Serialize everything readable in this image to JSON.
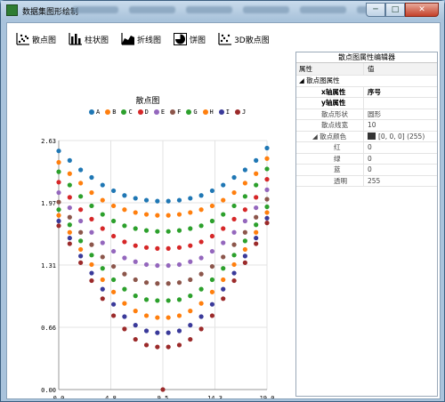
{
  "window": {
    "title": "数据集图形绘制",
    "controls": {
      "minimize": "─",
      "maximize": "□",
      "close": "✕"
    }
  },
  "toolbar": {
    "items": [
      {
        "label": "散点图",
        "icon": "scatter-icon"
      },
      {
        "label": "柱状图",
        "icon": "bar-icon"
      },
      {
        "label": "折线图",
        "icon": "area-icon"
      },
      {
        "label": "饼图",
        "icon": "pie-icon"
      },
      {
        "label": "3D散点图",
        "icon": "scatter3d-icon"
      }
    ]
  },
  "chart_data": {
    "type": "scatter",
    "title": "散点图",
    "xlim": [
      0.0,
      19.0
    ],
    "ylim": [
      0.0,
      2.63
    ],
    "xticks": [
      "0.0",
      "4.8",
      "9.5",
      "14.3",
      "19.0"
    ],
    "yticks": [
      "0.00",
      "0.66",
      "1.31",
      "1.97",
      "2.63"
    ],
    "grid": true,
    "legend_position": "top",
    "x": [
      0,
      1,
      2,
      3,
      4,
      5,
      6,
      7,
      8,
      9,
      10,
      11,
      12,
      13,
      14,
      15,
      16,
      17,
      18,
      19
    ],
    "series": [
      {
        "name": "A",
        "color": "#1f77b4",
        "values": [
          2.52,
          2.42,
          2.32,
          2.24,
          2.16,
          2.1,
          2.05,
          2.02,
          2.0,
          1.99,
          1.99,
          2.0,
          2.02,
          2.05,
          2.1,
          2.16,
          2.24,
          2.32,
          2.42,
          2.55
        ]
      },
      {
        "name": "B",
        "color": "#ff7f0e",
        "values": [
          2.4,
          2.28,
          2.18,
          2.08,
          2.0,
          1.94,
          1.9,
          1.87,
          1.85,
          1.84,
          1.84,
          1.85,
          1.87,
          1.9,
          1.94,
          2.0,
          2.08,
          2.18,
          2.28,
          2.44
        ]
      },
      {
        "name": "C",
        "color": "#2ca02c",
        "values": [
          2.3,
          2.16,
          2.04,
          1.94,
          1.85,
          1.78,
          1.73,
          1.7,
          1.68,
          1.67,
          1.67,
          1.68,
          1.7,
          1.73,
          1.78,
          1.85,
          1.94,
          2.04,
          2.16,
          2.33
        ]
      },
      {
        "name": "D",
        "color": "#d62728",
        "values": [
          2.19,
          2.03,
          1.9,
          1.8,
          1.7,
          1.62,
          1.56,
          1.52,
          1.5,
          1.49,
          1.49,
          1.5,
          1.52,
          1.56,
          1.62,
          1.7,
          1.8,
          1.9,
          2.03,
          2.22
        ]
      },
      {
        "name": "E",
        "color": "#9467bd",
        "values": [
          2.08,
          1.92,
          1.78,
          1.66,
          1.55,
          1.46,
          1.39,
          1.35,
          1.32,
          1.31,
          1.31,
          1.32,
          1.35,
          1.39,
          1.46,
          1.55,
          1.66,
          1.78,
          1.92,
          2.11
        ]
      },
      {
        "name": "F",
        "color": "#8c564b",
        "values": [
          1.98,
          1.82,
          1.66,
          1.53,
          1.4,
          1.3,
          1.22,
          1.16,
          1.13,
          1.12,
          1.12,
          1.13,
          1.16,
          1.22,
          1.3,
          1.4,
          1.53,
          1.66,
          1.82,
          2.01
        ]
      },
      {
        "name": "G",
        "color": "#2ca02c",
        "values": [
          1.9,
          1.74,
          1.57,
          1.42,
          1.28,
          1.16,
          1.06,
          0.99,
          0.95,
          0.94,
          0.94,
          0.95,
          0.99,
          1.06,
          1.16,
          1.28,
          1.42,
          1.57,
          1.74,
          1.93
        ]
      },
      {
        "name": "H",
        "color": "#ff7f0e",
        "values": [
          1.84,
          1.66,
          1.48,
          1.32,
          1.16,
          1.03,
          0.91,
          0.83,
          0.78,
          0.76,
          0.76,
          0.78,
          0.83,
          0.91,
          1.03,
          1.16,
          1.32,
          1.48,
          1.66,
          1.87
        ]
      },
      {
        "name": "I",
        "color": "#3a3a9a",
        "values": [
          1.78,
          1.6,
          1.41,
          1.23,
          1.06,
          0.9,
          0.77,
          0.68,
          0.62,
          0.6,
          0.6,
          0.62,
          0.68,
          0.77,
          0.9,
          1.06,
          1.23,
          1.41,
          1.6,
          1.81
        ]
      },
      {
        "name": "J",
        "color": "#9b2a2a",
        "values": [
          1.73,
          1.54,
          1.34,
          1.15,
          0.96,
          0.78,
          0.64,
          0.53,
          0.47,
          0.45,
          0.45,
          0.47,
          0.53,
          0.64,
          0.78,
          0.96,
          1.15,
          1.34,
          1.54,
          1.76
        ]
      }
    ],
    "extra_points": [
      {
        "x": 9.5,
        "y": 0.0,
        "color": "#9b2a2a"
      }
    ]
  },
  "properties": {
    "title": "散点图属性编辑器",
    "header": {
      "name": "属性",
      "value": "值"
    },
    "group": "散点图属性",
    "rows": [
      {
        "name": "x轴属性",
        "value": "序号",
        "bold": true
      },
      {
        "name": "y轴属性",
        "value": "",
        "bold": true
      },
      {
        "name": "散点形状",
        "value": "圆形"
      },
      {
        "name": "散点线宽",
        "value": "10"
      },
      {
        "name": "散点颜色",
        "value": "[0, 0, 0] (255)"
      }
    ],
    "color_sub": [
      {
        "name": "红",
        "value": "0"
      },
      {
        "name": "绿",
        "value": "0"
      },
      {
        "name": "蓝",
        "value": "0"
      },
      {
        "name": "透明",
        "value": "255"
      }
    ]
  }
}
